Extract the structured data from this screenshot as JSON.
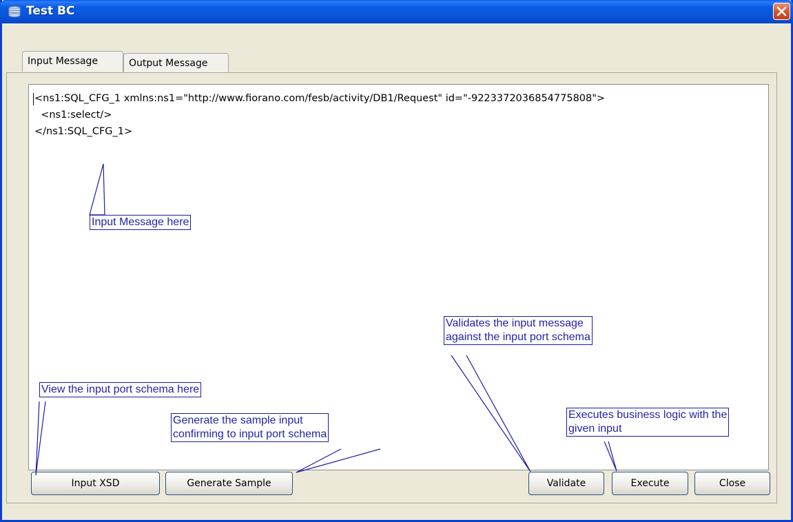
{
  "window": {
    "title": "Test BC"
  },
  "tabs": [
    {
      "label": "Input Message",
      "active": true
    },
    {
      "label": "Output Message",
      "active": false
    }
  ],
  "editor": {
    "lines": [
      "<ns1:SQL_CFG_1 xmlns:ns1=\"http://www.fiorano.com/fesb/activity/DB1/Request\" id=\"-9223372036854775808\">",
      "  <ns1:select/>",
      "</ns1:SQL_CFG_1>"
    ]
  },
  "buttons": {
    "input_xsd": "Input XSD",
    "generate_sample": "Generate Sample",
    "validate": "Validate",
    "execute": "Execute",
    "close": "Close"
  },
  "annotations": {
    "input_message": "Input Message here",
    "input_port_schema": "View the input port schema here",
    "generate_sample": "Generate the sample input\nconfirming to input port schema",
    "validate": "Validates the input message\nagainst the input port schema",
    "execute": "Executes business logic with the\ngiven input"
  },
  "colors": {
    "title_bar": "#0a5cf0",
    "annotation": "#2323a8",
    "active_tab_accent": "#f7a24a"
  }
}
